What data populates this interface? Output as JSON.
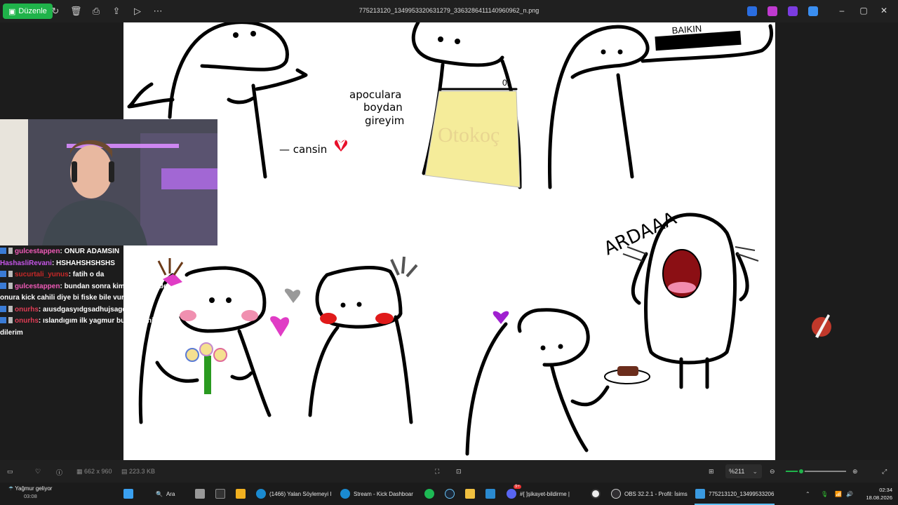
{
  "toolbar": {
    "edit_label": "Düzenle",
    "file_title": "775213120_1349953320631279_3363286411140960962_n.png"
  },
  "drawing": {
    "captions": {
      "apoculara": "apoculara",
      "boydan": "boydan",
      "gireyim": "gireyim",
      "cansin": "— cansin",
      "ardaaa": "ARDAAA",
      "otokoc": "Otokoç",
      "baikin": "BAIKIN",
      "number": "01"
    },
    "colors": {
      "heart": "#e8102a",
      "pink": "#e03cc5",
      "yellow": "#f5ec9a",
      "blush": "#f090b0",
      "red_blush": "#e01a1a"
    }
  },
  "chat": {
    "messages": [
      {
        "user": "gulcestappen",
        "user_color": "#f05bb8",
        "text": ": ONUR ADAMSIN",
        "badges": true
      },
      {
        "user": "HashasliRevani",
        "user_color": "#c655e8",
        "text": ": HSHAHSHSHSHS",
        "badges": false
      },
      {
        "user": "sucurtali_yunus",
        "user_color": "#c62828",
        "text": ": fatih o da",
        "badges": true
      },
      {
        "user": "gulcestappen",
        "user_color": "#f05bb8",
        "text": ": bundan sonra kimse bu ulkede",
        "badges": true
      },
      {
        "user": "",
        "user_color": "#fff",
        "text": "onura kick cahili diye bi fiske bile vurmayacak",
        "badges": false
      },
      {
        "user": "onurhs",
        "user_color": "#e03c55",
        "text": ": aıusdgasyıdgsadhujsagdas",
        "badges": true
      },
      {
        "user": "onurhs",
        "user_color": "#e03c55",
        "text": ": ıslandıgım ilk yagmur bunda cahilim özür",
        "badges": true
      },
      {
        "user": "",
        "user_color": "#fff",
        "text": "dilerim",
        "badges": false
      }
    ]
  },
  "statusbar": {
    "dimensions": "662 x 960",
    "filesize": "223.3 KB",
    "zoom": "%211",
    "zoom_fraction": 0.25
  },
  "taskbar": {
    "weather_title": "Yağmur geliyor",
    "weather_time": "03:08",
    "search": "Ara",
    "items": [
      "(1466) Yalan Söylemeyi I",
      "Stream - Kick Dashboar",
      "#[ ]şikayet-bildirme |",
      "OBS 32.2.1 - Profil: İsims",
      "775213120_13499533206"
    ],
    "discord_badge": "9+",
    "time": "02:34",
    "date": "18.08.2026"
  }
}
